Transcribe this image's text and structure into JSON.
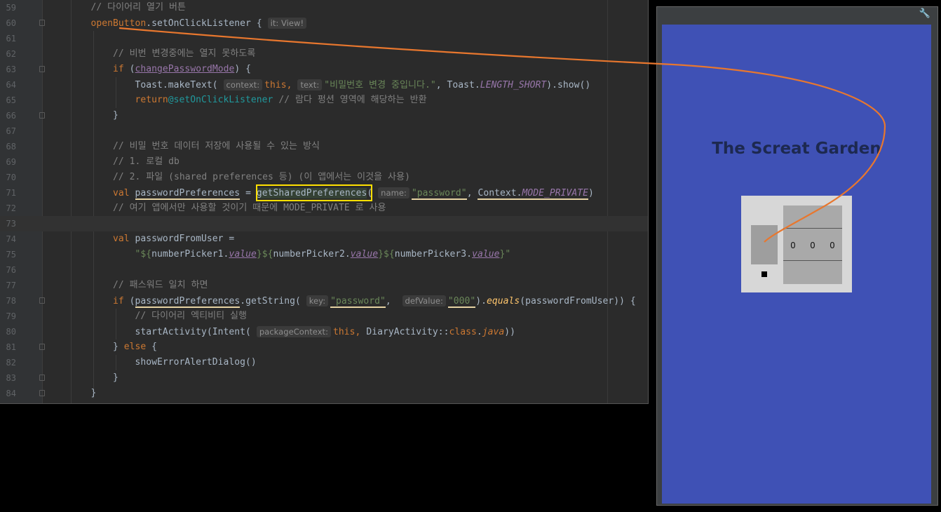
{
  "editor": {
    "lines": [
      {
        "n": "59",
        "parts": [
          [
            "cm",
            "    // 다이어리 열기 버튼"
          ]
        ]
      },
      {
        "n": "60",
        "parts": [
          [
            "kw",
            "    openButton"
          ],
          [
            "t",
            ".setOnClickListener { "
          ],
          [
            "hint",
            "it: View!"
          ]
        ]
      },
      {
        "n": "61",
        "parts": []
      },
      {
        "n": "62",
        "parts": [
          [
            "cm",
            "        // 비번 변경중에는 열지 못하도록"
          ]
        ]
      },
      {
        "n": "63",
        "parts": [
          [
            "kw",
            "        if "
          ],
          [
            "t",
            "("
          ],
          [
            "fld_ul",
            "changePasswordMode"
          ],
          [
            "t",
            ") {"
          ]
        ]
      },
      {
        "n": "64",
        "parts": [
          [
            "t",
            "            Toast.makeText( "
          ],
          [
            "hint",
            "context:"
          ],
          [
            "kw",
            "this, "
          ],
          [
            "hint",
            "text:"
          ],
          [
            "str",
            "\"비밀번호 변경 중입니다.\""
          ],
          [
            "t",
            ", Toast."
          ],
          [
            "fld_it",
            "LENGTH_SHORT"
          ],
          [
            "t",
            ").show()"
          ]
        ]
      },
      {
        "n": "65",
        "parts": [
          [
            "kw",
            "            return"
          ],
          [
            "lbl",
            "@setOnClickListener"
          ],
          [
            "cm",
            " // 람다 펑션 영역에 해당하는 반환"
          ]
        ]
      },
      {
        "n": "66",
        "parts": [
          [
            "t",
            "        }"
          ]
        ]
      },
      {
        "n": "67",
        "parts": []
      },
      {
        "n": "68",
        "parts": [
          [
            "cm",
            "        // 비밀 번호 데이터 저장에 사용될 수 있는 방식"
          ]
        ]
      },
      {
        "n": "69",
        "parts": [
          [
            "cm",
            "        // 1. 로컬 db"
          ]
        ]
      },
      {
        "n": "70",
        "parts": [
          [
            "cm",
            "        // 2. 파일 (shared preferences 등) (이 앱에서는 이것을 사용)"
          ]
        ]
      },
      {
        "n": "71",
        "parts": [
          [
            "kw",
            "        val "
          ],
          [
            "ul",
            "passwordPreferences"
          ],
          [
            "t",
            " = "
          ],
          [
            "match",
            "getSharedPreferences"
          ],
          [
            "t",
            "( "
          ],
          [
            "hint",
            "name:"
          ],
          [
            "str_ul",
            "\"password\""
          ],
          [
            "t",
            ", "
          ],
          [
            "ul",
            "Context."
          ],
          [
            "fld_it_ul",
            "MODE_PRIVATE"
          ],
          [
            "t",
            ")"
          ]
        ]
      },
      {
        "n": "72",
        "parts": [
          [
            "cm",
            "        // 여기 앱에서만 사용할 것이기 때문에 MODE_PRIVATE 로 사용"
          ]
        ]
      },
      {
        "n": "73",
        "parts": []
      },
      {
        "n": "74",
        "parts": [
          [
            "kw",
            "        val "
          ],
          [
            "t",
            "passwordFromUser ="
          ]
        ]
      },
      {
        "n": "75",
        "parts": [
          [
            "str",
            "            \"${"
          ],
          [
            "t",
            "numberPicker1."
          ],
          [
            "fld_it_u",
            "value"
          ],
          [
            "str",
            "}${"
          ],
          [
            "t",
            "numberPicker2."
          ],
          [
            "fld_it_u",
            "value"
          ],
          [
            "str",
            "}${"
          ],
          [
            "t",
            "numberPicker3."
          ],
          [
            "fld_it_u",
            "value"
          ],
          [
            "str",
            "}\""
          ]
        ]
      },
      {
        "n": "76",
        "parts": []
      },
      {
        "n": "77",
        "parts": [
          [
            "cm",
            "        // 패스워드 일치 하면"
          ]
        ]
      },
      {
        "n": "78",
        "parts": [
          [
            "kw",
            "        if "
          ],
          [
            "t",
            "("
          ],
          [
            "ul",
            "passwordPreferences"
          ],
          [
            "t",
            ".getString( "
          ],
          [
            "hint",
            "key:"
          ],
          [
            "str_ul",
            "\"password\""
          ],
          [
            "t",
            ",  "
          ],
          [
            "hint",
            "defValue:"
          ],
          [
            "str_ul",
            "\"000\""
          ],
          [
            "t",
            ")."
          ],
          [
            "fn_it",
            "equals"
          ],
          [
            "t",
            "(passwordFromUser)) {"
          ]
        ]
      },
      {
        "n": "79",
        "parts": [
          [
            "cm",
            "            // 다이어리 엑티비티 실행"
          ]
        ]
      },
      {
        "n": "80",
        "parts": [
          [
            "t",
            "            startActivity(Intent( "
          ],
          [
            "hint",
            "packageContext:"
          ],
          [
            "kw",
            "this, "
          ],
          [
            "t",
            "DiaryActivity::"
          ],
          [
            "kw",
            "class"
          ],
          [
            "t",
            "."
          ],
          [
            "kw_it",
            "java"
          ],
          [
            "t",
            "))"
          ]
        ]
      },
      {
        "n": "81",
        "parts": [
          [
            "t",
            "        } "
          ],
          [
            "kw",
            "else "
          ],
          [
            "t",
            "{"
          ]
        ]
      },
      {
        "n": "82",
        "parts": [
          [
            "t",
            "            showErrorAlertDialog()"
          ]
        ]
      },
      {
        "n": "83",
        "parts": [
          [
            "t",
            "        }"
          ]
        ]
      },
      {
        "n": "84",
        "parts": [
          [
            "t",
            "    }"
          ]
        ]
      }
    ],
    "current_line": "73"
  },
  "emulator": {
    "toolbar_icon": "wrench-icon",
    "app_title": "The Screat Garden",
    "picker_values": [
      "0",
      "0",
      "0"
    ],
    "background_color": "#3f51b5"
  },
  "accent_colors": {
    "connector": "#e8772e",
    "highlight_box": "#ffe000"
  }
}
